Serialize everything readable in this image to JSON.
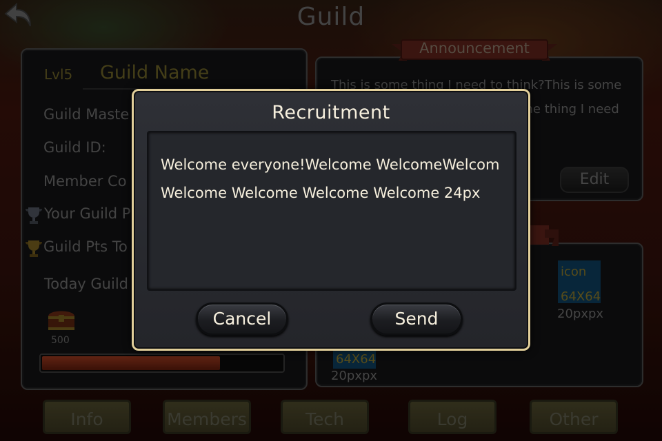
{
  "header": {
    "title": "Guild"
  },
  "guild": {
    "level": "Lvl5",
    "name": "Guild Name",
    "master_label": "Guild Maste",
    "id_label": "Guild ID:",
    "member_count_label": "Member Co",
    "your_pts_label": "Your Guild P",
    "pts_total_label": "Guild Pts To",
    "today_label": "Today Guild",
    "chest_value": "500",
    "progress_fraction": 0.74
  },
  "announcement": {
    "ribbon_label": "Announcement",
    "text": "This is some thing I need to think?This is some thing I need to think?This is some thing I need to think 20pxpxp",
    "edit_label": "Edit"
  },
  "rewards": {
    "icon_text": "icon",
    "icon_size_text": "64X64",
    "icon_caption": "20pxpx"
  },
  "tabs": [
    {
      "label": "Info"
    },
    {
      "label": "Members"
    },
    {
      "label": "Tech"
    },
    {
      "label": "Log"
    },
    {
      "label": "Other"
    }
  ],
  "modal": {
    "title": "Recruitment",
    "message_line1": "Welcome everyone!Welcome WelcomeWelcom",
    "message_line2": "Welcome Welcome Welcome Welcome 24px",
    "cancel_label": "Cancel",
    "send_label": "Send"
  },
  "colors": {
    "modal_border": "#e2cf9a",
    "modal_text": "#f6efdd",
    "progress_fill": "#9b3a20",
    "icon_placeholder": "#0d3e5e"
  }
}
